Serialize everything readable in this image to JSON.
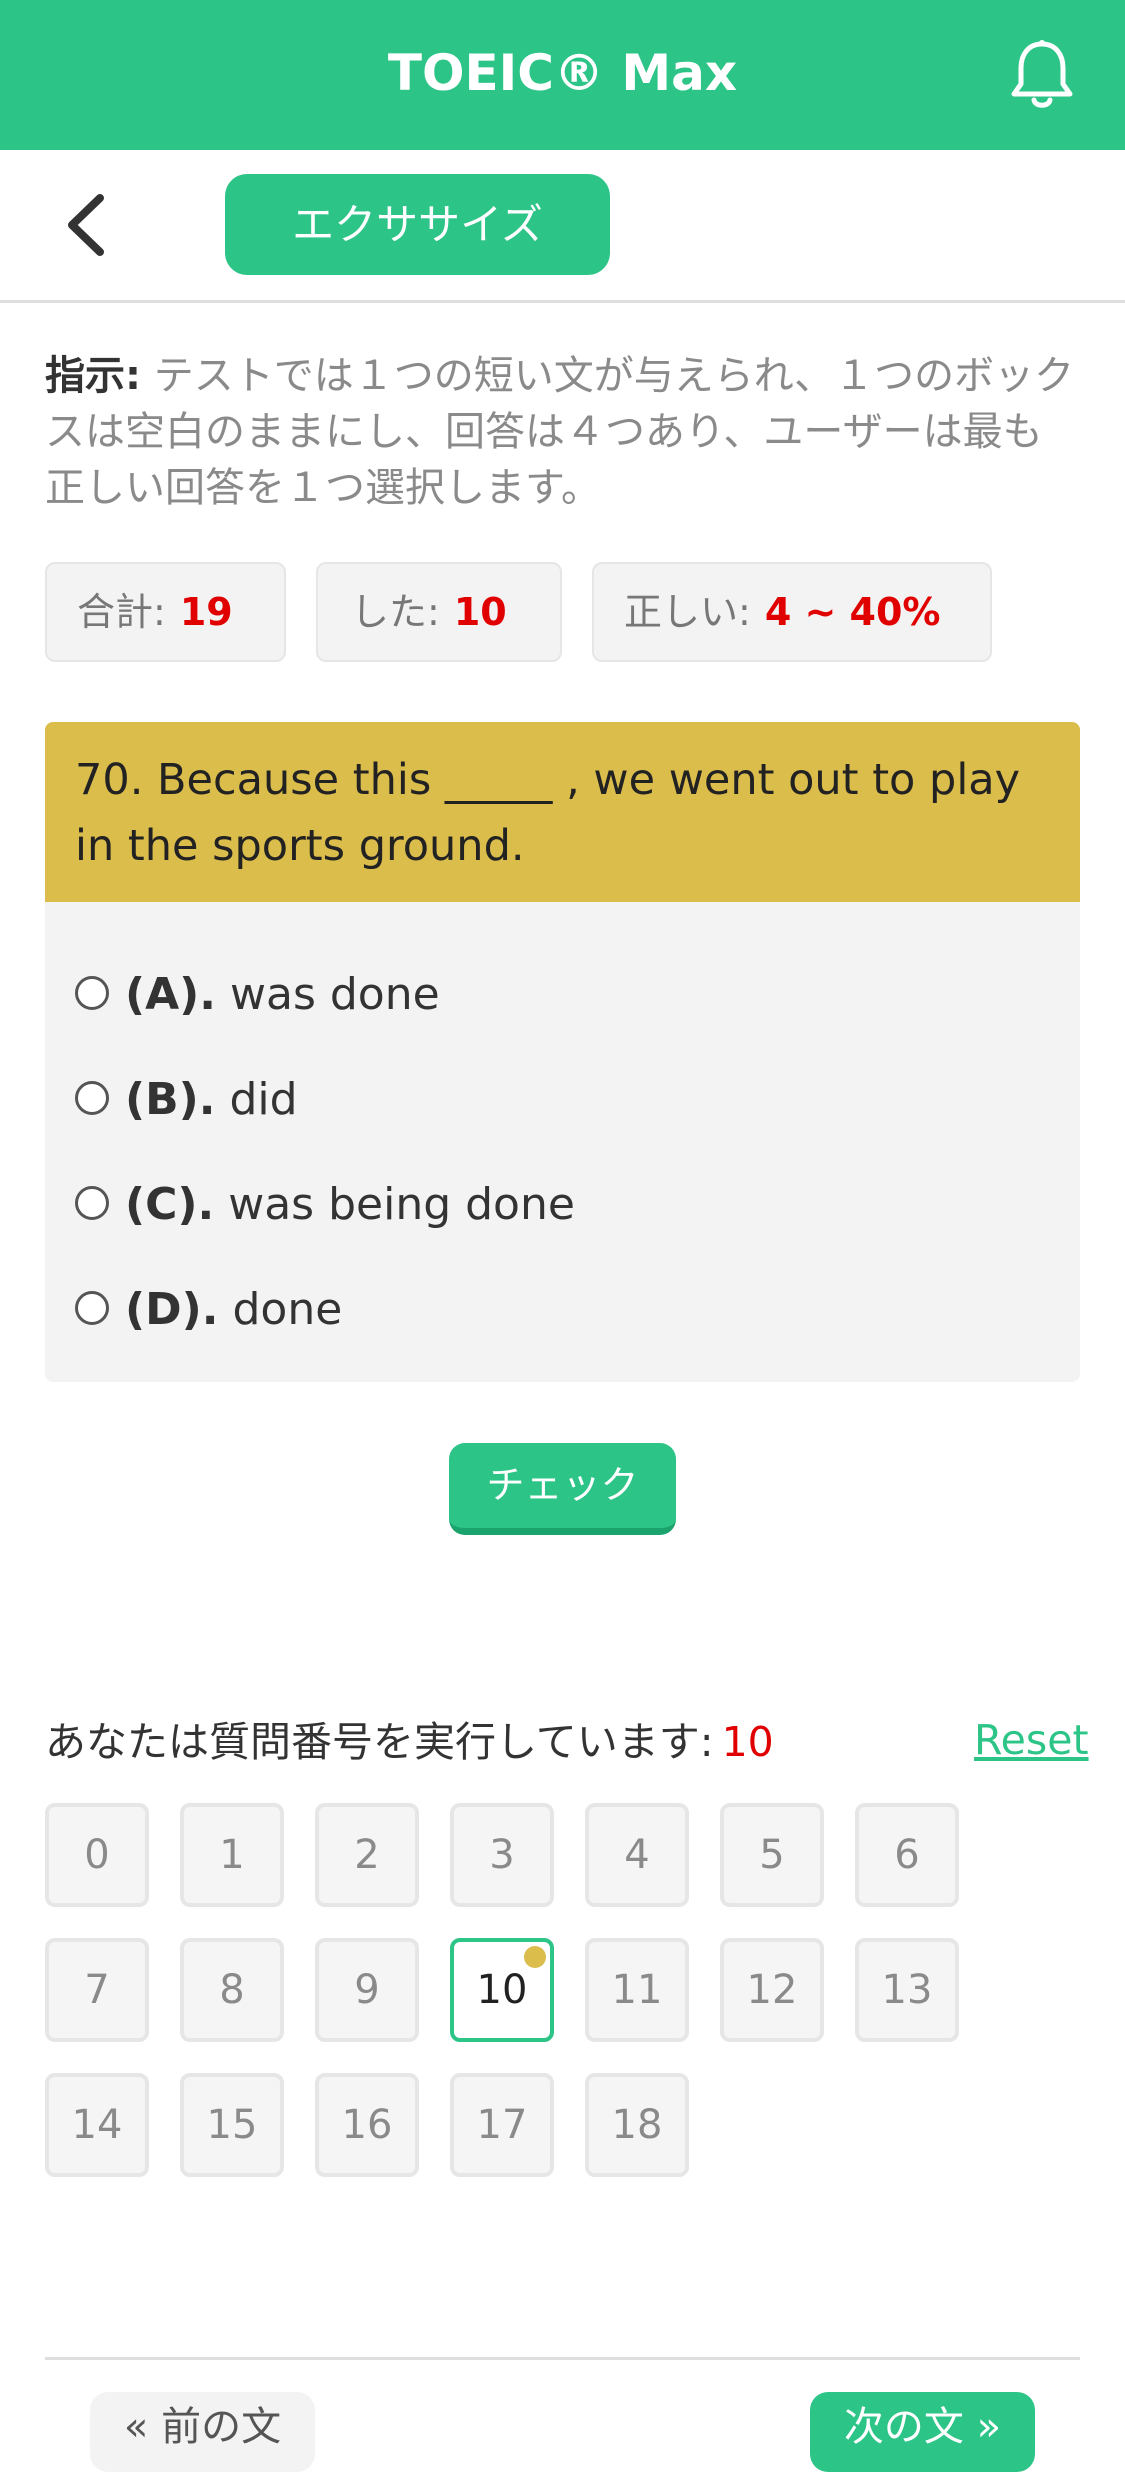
{
  "app": {
    "title": "TOEIC® Max",
    "bell_icon": "bell-icon",
    "back_icon": "chevron-left-icon",
    "tab_label": "エクササイズ"
  },
  "instructions": {
    "label": "指示:",
    "text": " テストでは１つの短い文が与えられ、１つのボックスは空白のままにし、回答は４つあり、ユーザーは最も正しい回答を１つ選択します。"
  },
  "stats": {
    "total_label": "合計:",
    "total_value": "19",
    "done_label": "した:",
    "done_value": "10",
    "correct_label": "正しい:",
    "correct_value": "4 ~ 40%"
  },
  "question": {
    "text": "70. Because this _____ , we went out to play in the sports ground.",
    "options": [
      {
        "key": "(A).",
        "text": "was done",
        "selected": false
      },
      {
        "key": "(B).",
        "text": "did",
        "selected": false
      },
      {
        "key": "(C).",
        "text": "was being done",
        "selected": false
      },
      {
        "key": "(D).",
        "text": "done",
        "selected": false
      }
    ]
  },
  "check_button": "チェック",
  "progress": {
    "running_label": "あなたは質問番号を実行しています:",
    "current": "10",
    "reset_label": "Reset",
    "numbers": [
      "0",
      "1",
      "2",
      "3",
      "4",
      "5",
      "6",
      "7",
      "8",
      "9",
      "10",
      "11",
      "12",
      "13",
      "14",
      "15",
      "16",
      "17",
      "18"
    ],
    "active_index": 10
  },
  "nav": {
    "prev_label": "« 前の文",
    "next_label": "次の文 »"
  },
  "colors": {
    "brand_green": "#2dc488",
    "question_header": "#dbbd4c",
    "highlight_red": "#e10000"
  }
}
